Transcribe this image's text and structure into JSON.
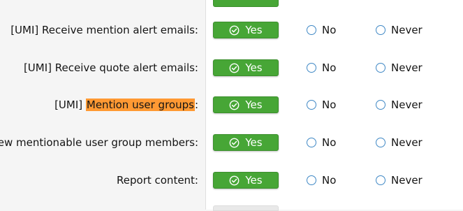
{
  "permissions": [
    {
      "label_prefix": "[UMI] Receive mention alert emails:",
      "label_highlight": "",
      "label_suffix": "",
      "yes": "Yes",
      "no": "No",
      "never": "Never"
    },
    {
      "label_prefix": "[UMI] Receive quote alert emails:",
      "label_highlight": "",
      "label_suffix": "",
      "yes": "Yes",
      "no": "No",
      "never": "Never"
    },
    {
      "label_prefix": "[UMI] ",
      "label_highlight": "Mention user groups",
      "label_suffix": ":",
      "yes": "Yes",
      "no": "No",
      "never": "Never"
    },
    {
      "label_prefix": "I] View mentionable user group members:",
      "label_highlight": "",
      "label_suffix": "",
      "yes": "Yes",
      "no": "No",
      "never": "Never"
    },
    {
      "label_prefix": "Report content:",
      "label_highlight": "",
      "label_suffix": "",
      "yes": "Yes",
      "no": "No",
      "never": "Never"
    }
  ],
  "colors": {
    "yes_green": "#47a636",
    "radio_blue": "#3f88c5",
    "search_highlight": "#ff9933"
  },
  "icons": {
    "yes": "check-circle-icon",
    "option": "radio-icon"
  }
}
